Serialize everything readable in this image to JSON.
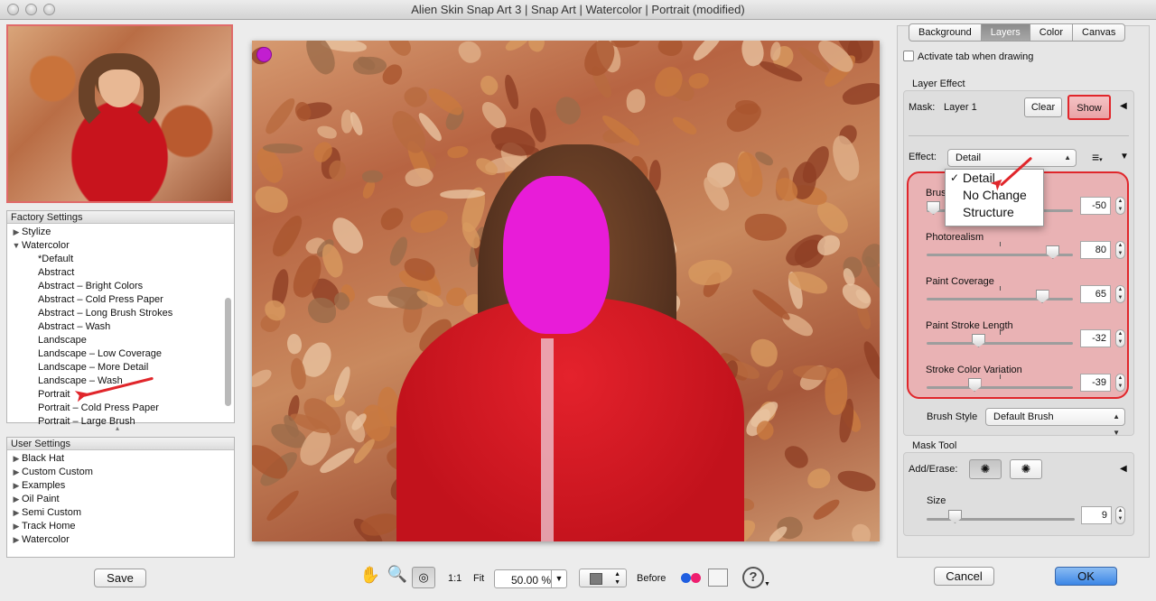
{
  "window": {
    "title": "Alien Skin Snap Art 3 | Snap Art | Watercolor | Portrait (modified)"
  },
  "factory_settings": {
    "header": "Factory Settings",
    "items": [
      {
        "label": "Stylize",
        "level": 0,
        "expanded": false
      },
      {
        "label": "Watercolor",
        "level": 0,
        "expanded": true
      },
      {
        "label": "*Default",
        "level": 1
      },
      {
        "label": "Abstract",
        "level": 1
      },
      {
        "label": "Abstract – Bright Colors",
        "level": 1
      },
      {
        "label": "Abstract – Cold Press Paper",
        "level": 1
      },
      {
        "label": "Abstract – Long Brush Strokes",
        "level": 1
      },
      {
        "label": "Abstract – Wash",
        "level": 1
      },
      {
        "label": "Landscape",
        "level": 1
      },
      {
        "label": "Landscape – Low Coverage",
        "level": 1
      },
      {
        "label": "Landscape – More Detail",
        "level": 1
      },
      {
        "label": "Landscape – Wash",
        "level": 1
      },
      {
        "label": "Portrait",
        "level": 1,
        "selected": true
      },
      {
        "label": "Portrait – Cold Press Paper",
        "level": 1
      },
      {
        "label": "Portrait – Large Brush",
        "level": 1
      }
    ]
  },
  "user_settings": {
    "header": "User Settings",
    "items": [
      {
        "label": "Black Hat"
      },
      {
        "label": "Custom Custom"
      },
      {
        "label": "Examples"
      },
      {
        "label": "Oil Paint"
      },
      {
        "label": "Semi Custom"
      },
      {
        "label": "Track Home"
      },
      {
        "label": "Watercolor"
      }
    ]
  },
  "buttons": {
    "save": "Save",
    "cancel": "Cancel",
    "ok": "OK",
    "clear": "Clear",
    "show": "Show"
  },
  "tabs": [
    {
      "label": "Background",
      "active": false
    },
    {
      "label": "Layers",
      "active": true
    },
    {
      "label": "Color",
      "active": false
    },
    {
      "label": "Canvas",
      "active": false
    }
  ],
  "activate_tab_label": "Activate tab when drawing",
  "layer_effect": {
    "title": "Layer Effect",
    "mask_label": "Mask:",
    "mask_value": "Layer 1",
    "effect_label": "Effect:",
    "effect_selected": "Detail",
    "effect_options": [
      "Detail",
      "No Change",
      "Structure"
    ],
    "sliders": [
      {
        "label": "Brush",
        "value": "-50",
        "level": 0.0
      },
      {
        "label": "Photorealism",
        "value": "80",
        "level": 0.9
      },
      {
        "label": "Paint Coverage",
        "value": "65",
        "level": 0.82
      },
      {
        "label": "Paint Stroke Length",
        "value": "-32",
        "level": 0.34
      },
      {
        "label": "Stroke Color Variation",
        "value": "-39",
        "level": 0.31
      }
    ],
    "brush_style_label": "Brush Style",
    "brush_style_value": "Default Brush"
  },
  "mask_tool": {
    "title": "Mask Tool",
    "add_erase_label": "Add/Erase:",
    "size_label": "Size",
    "size_value": "9",
    "size_level": 0.08
  },
  "toolbar": {
    "one_to_one": "1:1",
    "fit": "Fit",
    "zoom": "50.00 %",
    "before": "Before"
  },
  "colors": {
    "accent_red": "#e0262b",
    "highlight_panel": "#eab0b2",
    "ok_blue": "#4a8fe8",
    "mask_magenta": "#e81cd8"
  }
}
